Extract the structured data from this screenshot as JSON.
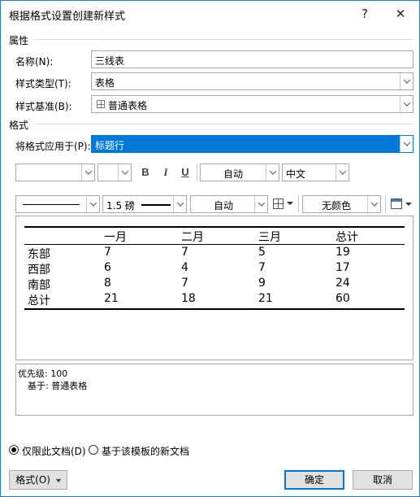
{
  "dialog": {
    "title": "根据格式设置创建新样式",
    "help_label": "?",
    "close_label": "✕"
  },
  "properties": {
    "section_label": "属性",
    "name_label": "名称(N):",
    "name_value": "三线表",
    "style_type_label": "样式类型(T):",
    "style_type_value": "表格",
    "based_on_label": "样式基准(B):",
    "based_on_value": "普通表格"
  },
  "format": {
    "section_label": "格式",
    "apply_to_label": "将格式应用于(P):",
    "apply_to_value": "标题行",
    "font_name_value": "",
    "font_size_value": "",
    "bold_label": "B",
    "italic_label": "I",
    "underline_label": "U",
    "font_color_value": "自动",
    "script_value": "中文",
    "border_weight_value": "1.5 磅",
    "border_color_value": "自动",
    "shading_value": "无颜色"
  },
  "preview_table": {
    "headers": [
      "",
      "一月",
      "二月",
      "三月",
      "总计"
    ],
    "rows": [
      [
        "东部",
        "7",
        "7",
        "5",
        "19"
      ],
      [
        "西部",
        "6",
        "4",
        "7",
        "17"
      ],
      [
        "南部",
        "8",
        "7",
        "9",
        "24"
      ],
      [
        "总计",
        "21",
        "18",
        "21",
        "60"
      ]
    ]
  },
  "description": {
    "line1": "优先级: 100",
    "line2": "基于: 普通表格"
  },
  "options": {
    "this_doc_label": "仅限此文档(D)",
    "template_label": "基于该模板的新文档"
  },
  "buttons": {
    "format_label": "格式(O)",
    "ok_label": "确定",
    "cancel_label": "取消"
  },
  "colors": {
    "accent": "#0078d7",
    "border": "#2b78c9"
  }
}
